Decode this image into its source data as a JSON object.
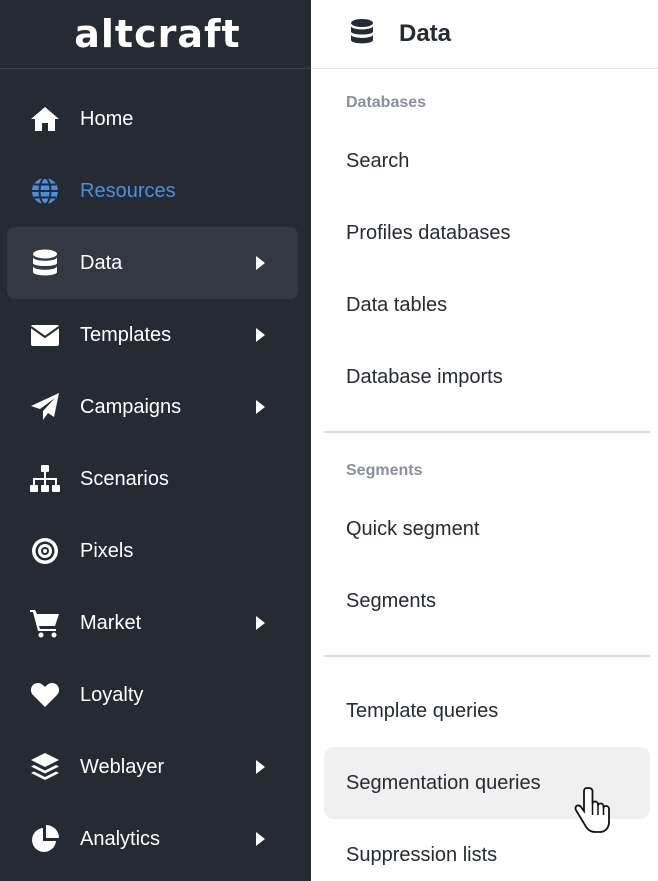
{
  "app": {
    "logo_text": "altcraft",
    "accent_color": "#4a90e2",
    "sidebar_bg": "#262a33"
  },
  "sidebar": {
    "items": [
      {
        "label": "Home",
        "icon": "home-icon",
        "submenu": false,
        "selected": false
      },
      {
        "label": "Resources",
        "icon": "globe-icon",
        "submenu": false,
        "selected": true
      },
      {
        "label": "Data",
        "icon": "database-icon",
        "submenu": true,
        "selected": false,
        "highlighted": true
      },
      {
        "label": "Templates",
        "icon": "envelope-icon",
        "submenu": true,
        "selected": false
      },
      {
        "label": "Campaigns",
        "icon": "paper-plane-icon",
        "submenu": true,
        "selected": false
      },
      {
        "label": "Scenarios",
        "icon": "sitemap-icon",
        "submenu": false,
        "selected": false
      },
      {
        "label": "Pixels",
        "icon": "target-icon",
        "submenu": false,
        "selected": false
      },
      {
        "label": "Market",
        "icon": "cart-icon",
        "submenu": true,
        "selected": false
      },
      {
        "label": "Loyalty",
        "icon": "heart-icon",
        "submenu": false,
        "selected": false
      },
      {
        "label": "Weblayer",
        "icon": "layers-icon",
        "submenu": true,
        "selected": false
      },
      {
        "label": "Analytics",
        "icon": "pie-chart-icon",
        "submenu": true,
        "selected": false
      }
    ]
  },
  "panel": {
    "title": "Data",
    "icon": "database-icon",
    "sections": [
      {
        "title": "Databases",
        "items": [
          "Search",
          "Profiles databases",
          "Data tables",
          "Database imports"
        ]
      },
      {
        "title": "Segments",
        "items": [
          "Quick segment",
          "Segments"
        ]
      },
      {
        "title": "",
        "items": [
          "Template queries",
          "Segmentation queries",
          "Suppression lists"
        ],
        "hovered_item": "Segmentation queries"
      }
    ]
  }
}
